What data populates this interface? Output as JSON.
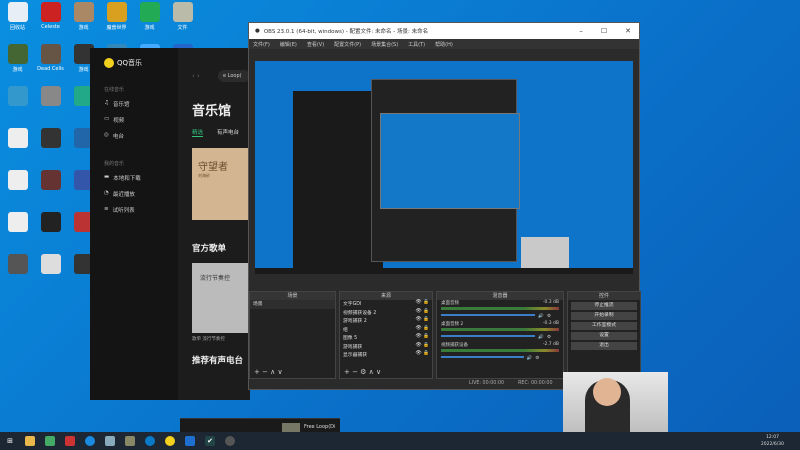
{
  "desktop": {
    "icons": [
      {
        "label": "回收站",
        "color": "#e8eef5"
      },
      {
        "label": "Celeste",
        "color": "#c22"
      },
      {
        "label": "游戏",
        "color": "#a86"
      },
      {
        "label": "魔兽世界",
        "color": "#d9a020"
      },
      {
        "label": "游戏",
        "color": "#2a5"
      },
      {
        "label": "文件",
        "color": "#bba"
      },
      {
        "label": "游戏",
        "color": "#463"
      },
      {
        "label": "Dead Cells",
        "color": "#654"
      },
      {
        "label": "游戏",
        "color": "#333"
      },
      {
        "label": "",
        "color": "#38b"
      },
      {
        "label": "",
        "color": "#4af"
      },
      {
        "label": "",
        "color": "#26c"
      },
      {
        "label": "",
        "color": "#39c"
      },
      {
        "label": "",
        "color": "#888"
      },
      {
        "label": "",
        "color": "#2a8"
      },
      {
        "label": "",
        "color": "#fff"
      },
      {
        "label": "",
        "color": "#c33"
      },
      {
        "label": "",
        "color": "#a73"
      },
      {
        "label": "",
        "color": "#eee"
      },
      {
        "label": "",
        "color": "#333"
      },
      {
        "label": "",
        "color": "#26a"
      },
      {
        "label": "",
        "color": "#eee"
      },
      {
        "label": "",
        "color": "#456"
      },
      {
        "label": "",
        "color": "#a55"
      },
      {
        "label": "",
        "color": "#eee"
      },
      {
        "label": "",
        "color": "#633"
      },
      {
        "label": "",
        "color": "#35a"
      },
      {
        "label": "",
        "color": "#eee"
      },
      {
        "label": "",
        "color": "#444"
      },
      {
        "label": "",
        "color": "#38c"
      },
      {
        "label": "",
        "color": "#eee"
      },
      {
        "label": "",
        "color": "#222"
      },
      {
        "label": "",
        "color": "#b33"
      },
      {
        "label": "",
        "color": "#eee"
      },
      {
        "label": "",
        "color": "#d33"
      },
      {
        "label": "",
        "color": "#333"
      },
      {
        "label": "",
        "color": "#555"
      },
      {
        "label": "",
        "color": "#ddd"
      },
      {
        "label": "",
        "color": "#333"
      },
      {
        "label": "",
        "color": "#a43"
      },
      {
        "label": "",
        "color": "#222"
      },
      {
        "label": "",
        "color": "#fc0"
      }
    ]
  },
  "qq": {
    "app_name": "QQ音乐",
    "search": "e Loop(",
    "online_section": "在线音乐",
    "online": [
      "音乐馆",
      "视频",
      "电台"
    ],
    "my_section": "我的音乐",
    "mine": [
      "本地和下载",
      "最近播放",
      "试听列表"
    ],
    "page_title": "音乐馆",
    "tabs": [
      "精选",
      "有声电台"
    ],
    "banner_title": "守望者",
    "banner_sub": "刘海砂",
    "playlist_heading": "官方歌单",
    "playlist_cover": "流行节奏控",
    "playlist_caption": "歌单 流行节奏控",
    "radio_heading": "推荐有声电台",
    "now_playing": "Free Loop(Di"
  },
  "obs": {
    "title": "OBS 23.0.1 (64-bit, windows) - 配置文件: 未命名 - 场景: 未命名",
    "menu": [
      "文件(F)",
      "编辑(E)",
      "查看(V)",
      "配置文件(P)",
      "场景集合(S)",
      "工具(T)",
      "帮助(H)"
    ],
    "docks": {
      "scenes": "场景",
      "sources": "来源",
      "mixer": "混音器",
      "controls": "控件"
    },
    "scenes": [
      "场景"
    ],
    "sources": [
      "文字GDI",
      "视频捕获设备 2",
      "游戏捕获 2",
      "组",
      "图像 5",
      "游戏捕获",
      "显示器捕获"
    ],
    "mixer": [
      {
        "name": "桌面音频",
        "db": "-0.3 dB",
        "level": 0.8
      },
      {
        "name": "桌面音频 2",
        "db": "-0.3 dB",
        "level": 0.8
      },
      {
        "name": "视频捕获设备",
        "db": "-2.7 dB",
        "level": 0.7
      }
    ],
    "controls": [
      "停止推流",
      "开始录制",
      "工作室模式",
      "设置",
      "退出"
    ],
    "live": "LIVE: 00:00:00",
    "rec": "REC: 00:00:00"
  },
  "taskbar": {
    "time": "12:07",
    "date": "2022/6/30"
  }
}
